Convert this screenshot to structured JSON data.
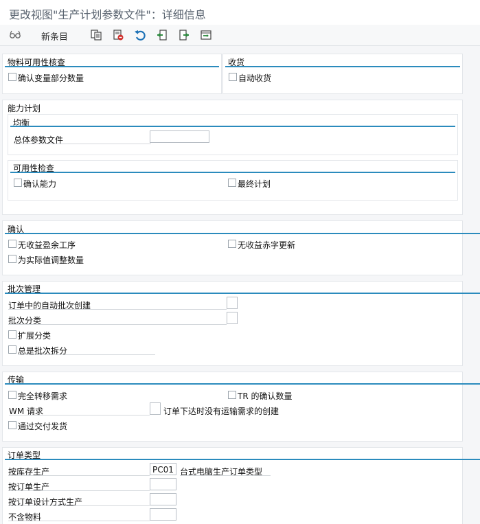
{
  "window": {
    "title": "更改视图\"生产计划参数文件\"：详细信息"
  },
  "toolbar": {
    "new_entries": "新条目",
    "icons": [
      "glasses-icon",
      "copy-icon",
      "delete-icon",
      "undo-icon",
      "prev-icon",
      "next-icon",
      "export-icon"
    ]
  },
  "material_check": {
    "title": "物料可用性核查",
    "confirm_changed_qty": "确认变量部分数量"
  },
  "goods_receipt": {
    "title": "收货",
    "auto_gr": "自动收货"
  },
  "capacity": {
    "title": "能力计划",
    "leveling": {
      "title": "均衡",
      "overall_profile_label": "总体参数文件",
      "overall_profile_value": ""
    },
    "availability": {
      "title": "可用性检查",
      "confirm_capacity": "确认能力",
      "final_schedule": "最终计划"
    }
  },
  "confirmation": {
    "title": "确认",
    "no_surplus_ops": "无收益盈余工序",
    "no_deficit_update": "无收益赤字更新",
    "adjust_actual_qty": "为实际值调整数量"
  },
  "batch": {
    "title": "批次管理",
    "auto_batch_creation": "订单中的自动批次创建",
    "batch_classification": "批次分类",
    "extended_classification": "扩展分类",
    "always_split": "总是批次拆分"
  },
  "transfer": {
    "title": "传输",
    "full_transfer_req": "完全转移需求",
    "tr_confirmed_qty": "TR 的确认数量",
    "wm_request": "WM 请求",
    "no_transport_req": "订单下达时没有运输需求的创建",
    "via_delivery": "通过交付发货"
  },
  "order_type": {
    "title": "订单类型",
    "rows": [
      {
        "label": "按库存生产",
        "value": "PC01",
        "desc": "台式电脑生产订单类型"
      },
      {
        "label": "按订单生产",
        "value": "",
        "desc": ""
      },
      {
        "label": "按订单设计方式生产",
        "value": "",
        "desc": ""
      },
      {
        "label": "不含物料",
        "value": "",
        "desc": ""
      }
    ]
  }
}
